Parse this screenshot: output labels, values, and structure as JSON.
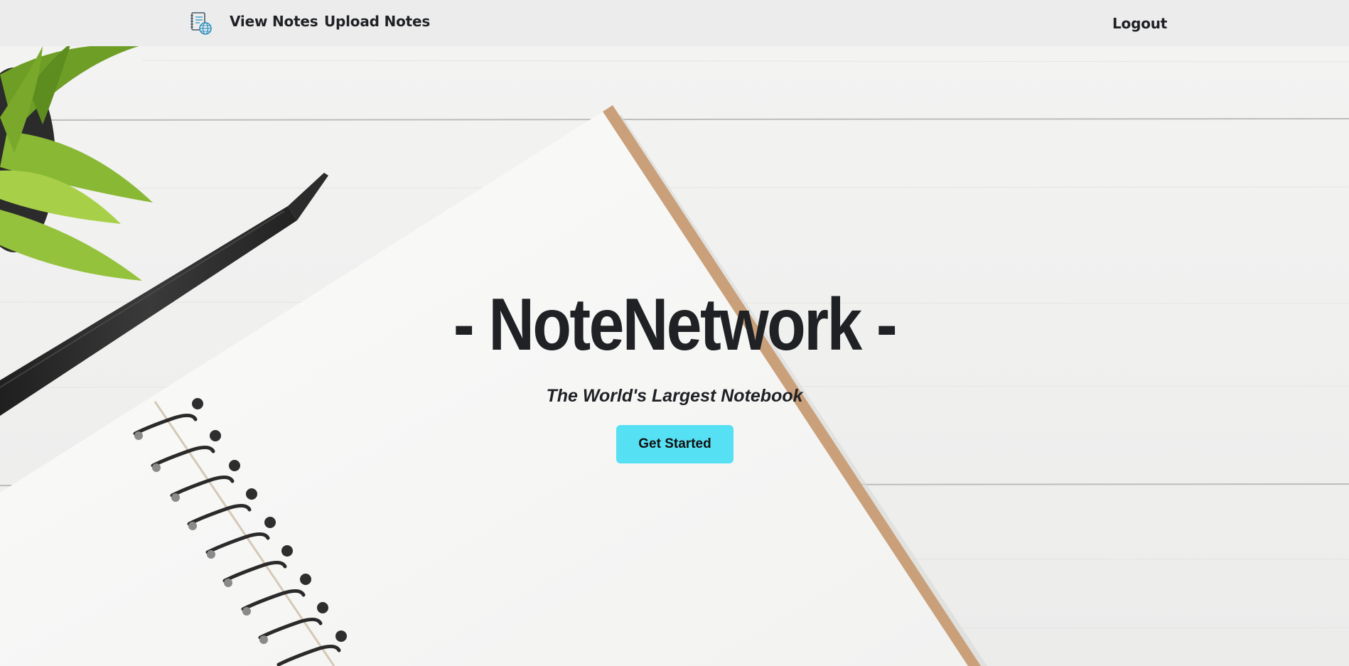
{
  "navbar": {
    "logo_icon": "notebook-globe-icon",
    "view_notes_label": "View Notes",
    "upload_notes_label": "Upload Notes",
    "logout_label": "Logout"
  },
  "hero": {
    "title": "- NoteNetwork -",
    "subtitle": "The World's Largest Notebook",
    "cta_label": "Get Started",
    "cta_color": "#56e0f4",
    "background_description_icon": "desk-notebook-pen-plant-photo"
  },
  "colors": {
    "navbar_bg": "#ececec",
    "text": "#1f2125",
    "accent": "#56e0f4"
  }
}
